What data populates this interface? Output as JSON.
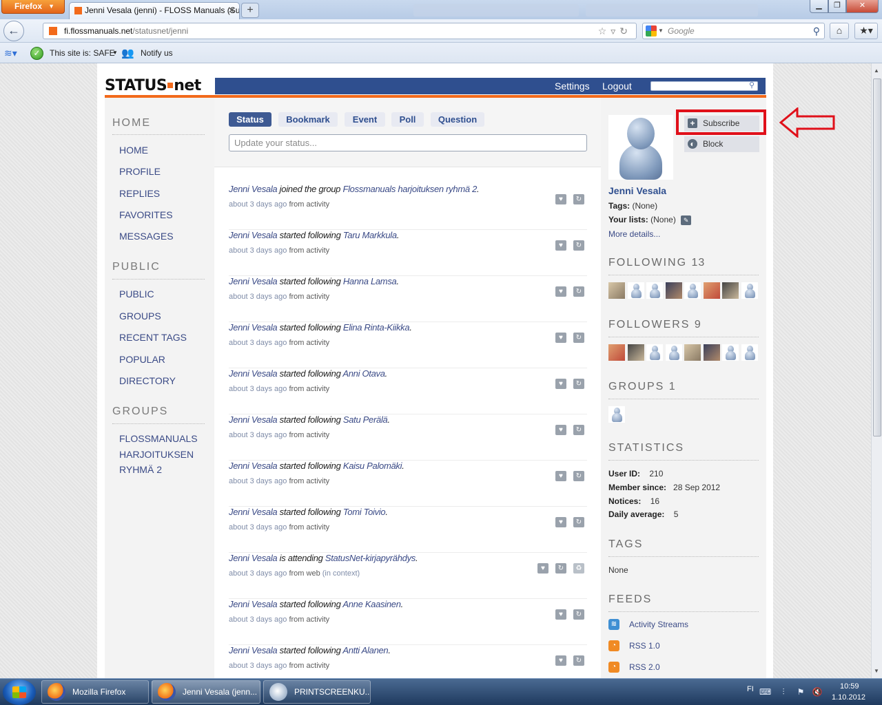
{
  "browser": {
    "app_button": "Firefox",
    "active_tab": "Jenni Vesala (jenni) - FLOSS Manuals (Su...",
    "url_domain": "fi.flossmanuals.net",
    "url_path": "/statusnet/jenni",
    "search_engine_placeholder": "Google",
    "addon_safe": "This site is: SAFE",
    "addon_notify": "Notify us"
  },
  "site": {
    "logo_left": "STATUS",
    "logo_right": "net",
    "nav_settings": "Settings",
    "nav_logout": "Logout"
  },
  "leftnav": {
    "home_head": "HOME",
    "home_links": [
      "HOME",
      "PROFILE",
      "REPLIES",
      "FAVORITES",
      "MESSAGES"
    ],
    "public_head": "PUBLIC",
    "public_links": [
      "PUBLIC",
      "GROUPS",
      "RECENT TAGS",
      "POPULAR",
      "DIRECTORY"
    ],
    "groups_head": "GROUPS",
    "group_links": [
      "FLOSSMANUALS",
      "HARJOITUKSEN",
      "RYHMÄ 2"
    ]
  },
  "composer": {
    "tabs": [
      "Status",
      "Bookmark",
      "Event",
      "Poll",
      "Question"
    ],
    "placeholder": "Update your status..."
  },
  "notices": [
    {
      "actor": "Jenni Vesala",
      "verb": " joined the group ",
      "object": "Flossmanuals harjoituksen ryhmä 2",
      "end": ".",
      "time": "about 3 days ago",
      "source": " from activity"
    },
    {
      "actor": "Jenni Vesala",
      "verb": " started following ",
      "object": "Taru Markkula",
      "end": ".",
      "time": "about 3 days ago",
      "source": " from activity"
    },
    {
      "actor": "Jenni Vesala",
      "verb": " started following ",
      "object": "Hanna Lamsa",
      "end": ".",
      "time": "about 3 days ago",
      "source": " from activity"
    },
    {
      "actor": "Jenni Vesala",
      "verb": " started following ",
      "object": "Elina Rinta-Kiikka",
      "end": ".",
      "time": "about 3 days ago",
      "source": " from activity"
    },
    {
      "actor": "Jenni Vesala",
      "verb": " started following ",
      "object": "Anni Otava",
      "end": ".",
      "time": "about 3 days ago",
      "source": " from activity"
    },
    {
      "actor": "Jenni Vesala",
      "verb": " started following ",
      "object": "Satu Perälä",
      "end": ".",
      "time": "about 3 days ago",
      "source": " from activity"
    },
    {
      "actor": "Jenni Vesala",
      "verb": " started following ",
      "object": "Kaisu Palomäki",
      "end": ".",
      "time": "about 3 days ago",
      "source": " from activity"
    },
    {
      "actor": "Jenni Vesala",
      "verb": " started following ",
      "object": "Tomi Toivio",
      "end": ".",
      "time": "about 3 days ago",
      "source": " from activity"
    },
    {
      "actor": "Jenni Vesala",
      "verb": " is attending ",
      "object": "StatusNet-kirjapyrähdys",
      "end": ".",
      "time": "about 3 days ago",
      "source": " from web ",
      "context": "(in context)"
    },
    {
      "actor": "Jenni Vesala",
      "verb": " started following ",
      "object": "Anne Kaasinen",
      "end": ".",
      "time": "about 3 days ago",
      "source": " from activity"
    },
    {
      "actor": "Jenni Vesala",
      "verb": " started following ",
      "object": "Antti Alanen",
      "end": ".",
      "time": "about 3 days ago",
      "source": " from activity"
    }
  ],
  "profile": {
    "subscribe": "Subscribe",
    "block": "Block",
    "name": "Jenni Vesala",
    "tags_label": "Tags:",
    "tags_value": "(None)",
    "lists_label": "Your lists:",
    "lists_value": "(None)",
    "more_details": "More details..."
  },
  "following": {
    "label": "FOLLOWING",
    "count": "13"
  },
  "followers": {
    "label": "FOLLOWERS",
    "count": "9"
  },
  "groups": {
    "label": "GROUPS",
    "count": "1"
  },
  "statistics": {
    "label": "STATISTICS",
    "rows": [
      {
        "label": "User ID:",
        "value": "210"
      },
      {
        "label": "Member since:",
        "value": "28 Sep 2012"
      },
      {
        "label": "Notices:",
        "value": "16"
      },
      {
        "label": "Daily average:",
        "value": "5"
      }
    ]
  },
  "tags": {
    "label": "TAGS",
    "value": "None"
  },
  "feeds": {
    "label": "FEEDS",
    "items": [
      {
        "label": "Activity Streams",
        "color": "#3f8fd3"
      },
      {
        "label": "RSS 1.0",
        "color": "#f08a24"
      },
      {
        "label": "RSS 2.0",
        "color": "#f08a24"
      }
    ]
  },
  "taskbar": {
    "items": [
      "Mozilla Firefox",
      "Jenni Vesala (jenn...",
      "PRINTSCREENKU..."
    ],
    "lang": "FI",
    "time": "10:59",
    "date": "1.10.2012"
  },
  "colors": {
    "accent": "#f26a1b",
    "brand": "#2f4f8f",
    "highlight": "#e0101a"
  }
}
